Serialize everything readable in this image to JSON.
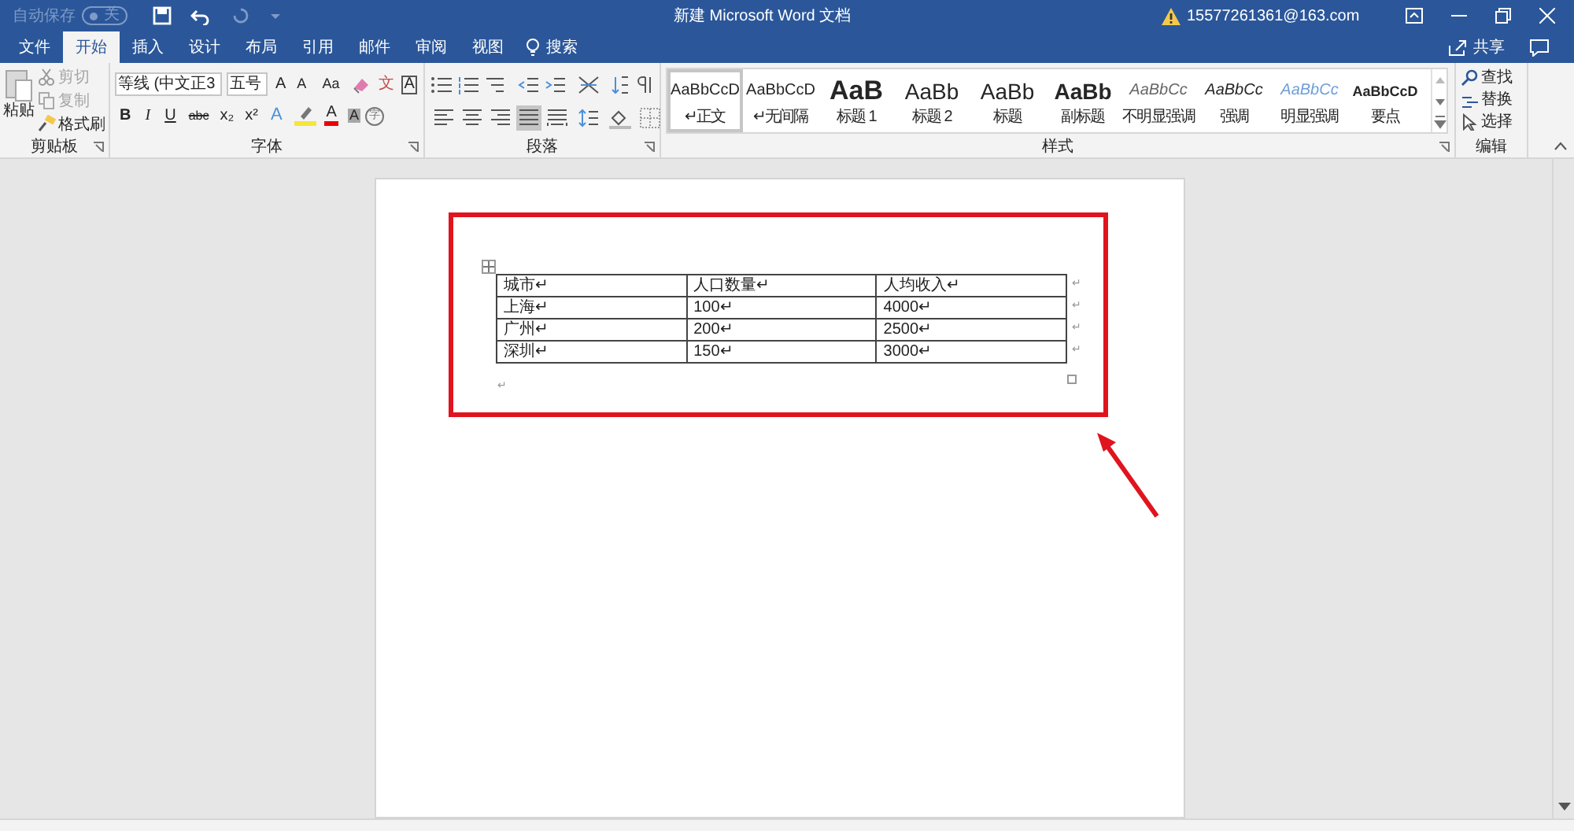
{
  "quick_access": {
    "autosave_label": "自动保存",
    "autosave_state": "关",
    "autosave_on": false
  },
  "window": {
    "title": "新建 Microsoft Word 文档",
    "account": "15577261361@163.com"
  },
  "tabs": [
    {
      "label": "文件",
      "selected": false
    },
    {
      "label": "开始",
      "selected": true
    },
    {
      "label": "插入",
      "selected": false
    },
    {
      "label": "设计",
      "selected": false
    },
    {
      "label": "布局",
      "selected": false
    },
    {
      "label": "引用",
      "selected": false
    },
    {
      "label": "邮件",
      "selected": false
    },
    {
      "label": "审阅",
      "selected": false
    },
    {
      "label": "视图",
      "selected": false
    }
  ],
  "search": {
    "label": "搜索"
  },
  "share": {
    "label": "共享"
  },
  "ribbon": {
    "clipboard": {
      "paste": "粘贴",
      "small_buttons": [
        {
          "label": "剪切",
          "kind": "cut",
          "disabled": true
        },
        {
          "label": "复制",
          "kind": "copy",
          "disabled": true
        },
        {
          "label": "格式刷",
          "kind": "painter",
          "disabled": false
        }
      ],
      "label": "剪贴板"
    },
    "font": {
      "name": "等线 (中文正3",
      "size": "五号",
      "row1": [
        {
          "text": "A",
          "kind": "grow"
        },
        {
          "text": "A",
          "kind": "shrink"
        },
        {
          "text": "Aa",
          "kind": "case"
        },
        {
          "kind": "clear"
        },
        {
          "text": "文",
          "kind": "phonetic"
        },
        {
          "text": "A",
          "kind": "border"
        }
      ],
      "row2": [
        {
          "text": "B",
          "kind": "bold"
        },
        {
          "text": "I",
          "kind": "italic"
        },
        {
          "text": "U",
          "kind": "underline"
        },
        {
          "text": "abc",
          "kind": "strike"
        },
        {
          "text": "x₂",
          "kind": "sub"
        },
        {
          "text": "x²",
          "kind": "sup"
        },
        {
          "text": "A",
          "kind": "effects"
        },
        {
          "kind": "highlight"
        },
        {
          "text": "A",
          "kind": "color"
        },
        {
          "text": "A",
          "kind": "shade"
        },
        {
          "text": "字",
          "kind": "enclose"
        }
      ],
      "label": "字体"
    },
    "paragraph": {
      "alignments": [
        {
          "selected": false
        },
        {
          "selected": false
        },
        {
          "selected": false
        },
        {
          "selected": true
        },
        {
          "selected": false
        }
      ],
      "label": "段落"
    },
    "styles": {
      "items": [
        {
          "preview": "AaBbCcD",
          "name": "↵正文",
          "kind": "normal",
          "selected": true
        },
        {
          "preview": "AaBbCcD",
          "name": "↵无间隔",
          "kind": "normal",
          "selected": false
        },
        {
          "preview": "AaB",
          "name": "标题 1",
          "kind": "heading1",
          "selected": false
        },
        {
          "preview": "AaBb",
          "name": "标题 2",
          "kind": "heading2",
          "selected": false
        },
        {
          "preview": "AaBb",
          "name": "标题",
          "kind": "title",
          "selected": false
        },
        {
          "preview": "AaBb",
          "name": "副标题",
          "kind": "subtitle",
          "selected": false
        },
        {
          "preview": "AaBbCc",
          "name": "不明显强调",
          "kind": "subtle",
          "selected": false
        },
        {
          "preview": "AaBbCc",
          "name": "强调",
          "kind": "emphasis",
          "selected": false
        },
        {
          "preview": "AaBbCc",
          "name": "明显强调",
          "kind": "intense",
          "selected": false
        },
        {
          "preview": "AaBbCcD",
          "name": "要点",
          "kind": "strong",
          "selected": false
        }
      ],
      "label": "样式"
    },
    "editing": {
      "find": "查找",
      "replace": "替换",
      "select": "选择",
      "label": "编辑"
    }
  },
  "document": {
    "table": {
      "rows": [
        {
          "cells": [
            "城市↵",
            "人口数量↵",
            "人均收入↵"
          ],
          "end_mark": "↵"
        },
        {
          "cells": [
            "上海↵",
            "100↵",
            "4000↵"
          ],
          "end_mark": "↵"
        },
        {
          "cells": [
            "广州↵",
            "200↵",
            "2500↵"
          ],
          "end_mark": "↵"
        },
        {
          "cells": [
            "深圳↵",
            "150↵",
            "3000↵"
          ],
          "end_mark": "↵"
        }
      ]
    },
    "end_mark": "↵"
  }
}
